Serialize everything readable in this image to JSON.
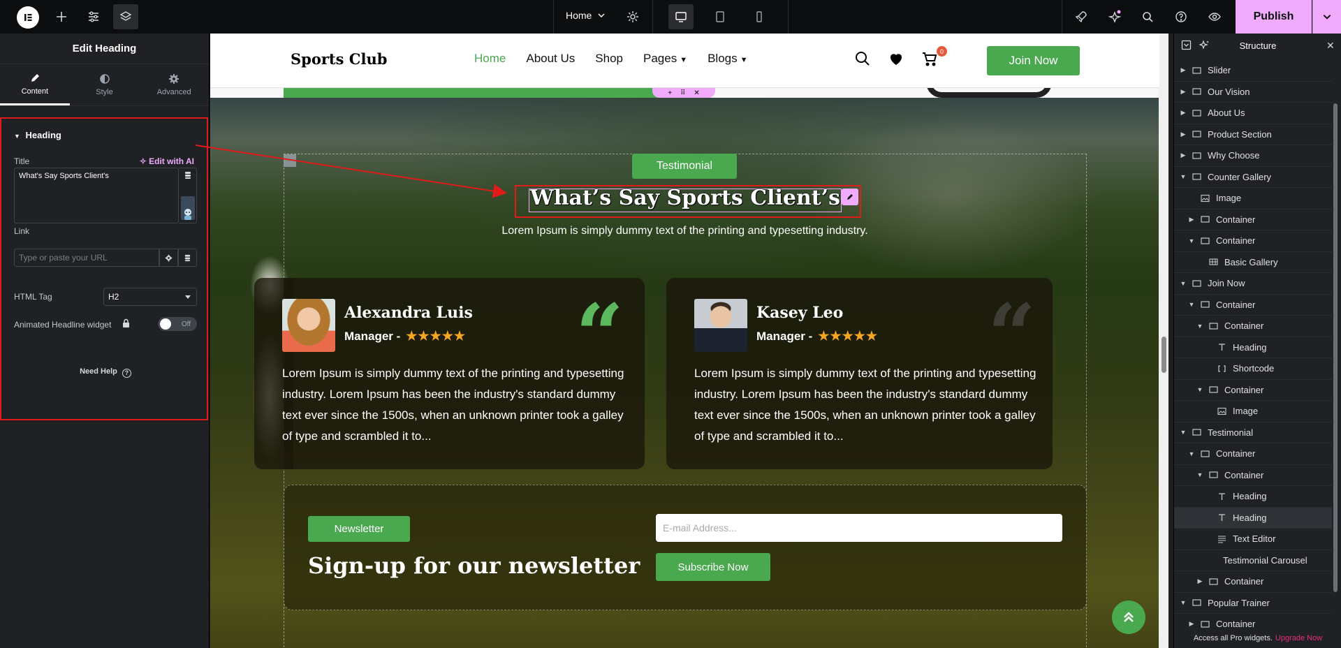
{
  "topbar": {
    "page_name": "Home",
    "publish_label": "Publish"
  },
  "left_panel": {
    "title": "Edit Heading",
    "tabs": [
      {
        "label": "Content"
      },
      {
        "label": "Style"
      },
      {
        "label": "Advanced"
      }
    ],
    "section_title": "Heading",
    "title_label": "Title",
    "edit_ai": "Edit with AI",
    "title_value": "What's Say Sports Client's",
    "link_label": "Link",
    "link_placeholder": "Type or paste your URL",
    "html_tag_label": "HTML Tag",
    "html_tag_value": "H2",
    "animated_label": "Animated Headline widget",
    "toggle_label": "Off",
    "need_help": "Need Help"
  },
  "site": {
    "brand": "Sports Club",
    "nav": [
      {
        "label": "Home"
      },
      {
        "label": "About Us"
      },
      {
        "label": "Shop"
      },
      {
        "label": "Pages"
      },
      {
        "label": "Blogs"
      }
    ],
    "cart_count": "0",
    "join_label": "Join Now",
    "testimonial_badge": "Testimonial",
    "heading": "What’s Say Sports Client’s",
    "subtitle": "Lorem Ipsum is simply dummy text of the printing and typesetting industry.",
    "testimonials": [
      {
        "name": "Alexandra Luis",
        "role": "Manager -",
        "rating": 5,
        "stars": "★★★★★",
        "body": "Lorem Ipsum is simply dummy text of the printing and typesetting industry. Lorem Ipsum has been the industry's standard dummy text ever since the 1500s, when an unknown printer took a galley of type and scrambled it to..."
      },
      {
        "name": "Kasey Leo",
        "role": "Manager -",
        "rating": 5,
        "stars": "★★★★★",
        "body": "Lorem Ipsum is simply dummy text of the printing and typesetting industry. Lorem Ipsum has been the industry's standard dummy text ever since the 1500s, when an unknown printer took a galley of type and scrambled it to..."
      }
    ],
    "newsletter_badge": "Newsletter",
    "newsletter_title": "Sign-up for our newsletter",
    "email_placeholder": "E-mail Address...",
    "subscribe_label": "Subscribe Now"
  },
  "structure": {
    "title": "Structure",
    "items": [
      {
        "label": "Slider",
        "depth": 0,
        "toggle": "right",
        "icon": "container"
      },
      {
        "label": "Our Vision",
        "depth": 0,
        "toggle": "right",
        "icon": "container"
      },
      {
        "label": "About Us",
        "depth": 0,
        "toggle": "right",
        "icon": "container"
      },
      {
        "label": "Product Section",
        "depth": 0,
        "toggle": "right",
        "icon": "container"
      },
      {
        "label": "Why Choose",
        "depth": 0,
        "toggle": "right",
        "icon": "container"
      },
      {
        "label": "Counter Gallery",
        "depth": 0,
        "toggle": "down",
        "icon": "container"
      },
      {
        "label": "Image",
        "depth": 1,
        "toggle": "",
        "icon": "image"
      },
      {
        "label": "Container",
        "depth": 1,
        "toggle": "right",
        "icon": "container"
      },
      {
        "label": "Container",
        "depth": 1,
        "toggle": "down",
        "icon": "container"
      },
      {
        "label": "Basic Gallery",
        "depth": 2,
        "toggle": "",
        "icon": "gallery"
      },
      {
        "label": "Join Now",
        "depth": 0,
        "toggle": "down",
        "icon": "container"
      },
      {
        "label": "Container",
        "depth": 1,
        "toggle": "down",
        "icon": "container"
      },
      {
        "label": "Container",
        "depth": 2,
        "toggle": "down",
        "icon": "container"
      },
      {
        "label": "Heading",
        "depth": 3,
        "toggle": "",
        "icon": "heading"
      },
      {
        "label": "Shortcode",
        "depth": 3,
        "toggle": "",
        "icon": "shortcode"
      },
      {
        "label": "Container",
        "depth": 2,
        "toggle": "down",
        "icon": "container"
      },
      {
        "label": "Image",
        "depth": 3,
        "toggle": "",
        "icon": "image"
      },
      {
        "label": "Testimonial",
        "depth": 0,
        "toggle": "down",
        "icon": "container"
      },
      {
        "label": "Container",
        "depth": 1,
        "toggle": "down",
        "icon": "container"
      },
      {
        "label": "Container",
        "depth": 2,
        "toggle": "down",
        "icon": "container"
      },
      {
        "label": "Heading",
        "depth": 3,
        "toggle": "",
        "icon": "heading"
      },
      {
        "label": "Heading",
        "depth": 3,
        "toggle": "",
        "icon": "heading",
        "selected": true
      },
      {
        "label": "Text Editor",
        "depth": 3,
        "toggle": "",
        "icon": "text"
      },
      {
        "label": "Testimonial Carousel",
        "depth": 3,
        "toggle": "",
        "icon": "none"
      },
      {
        "label": "Container",
        "depth": 2,
        "toggle": "right",
        "icon": "container"
      },
      {
        "label": "Popular Trainer",
        "depth": 0,
        "toggle": "down",
        "icon": "container"
      },
      {
        "label": "Container",
        "depth": 1,
        "toggle": "right",
        "icon": "container"
      }
    ],
    "footer_text": "Access all Pro widgets.",
    "footer_link": "Upgrade Now"
  },
  "colors": {
    "accent": "#f0abfc",
    "site_green": "#4aa84f",
    "annotation_red": "#e11a1a"
  }
}
